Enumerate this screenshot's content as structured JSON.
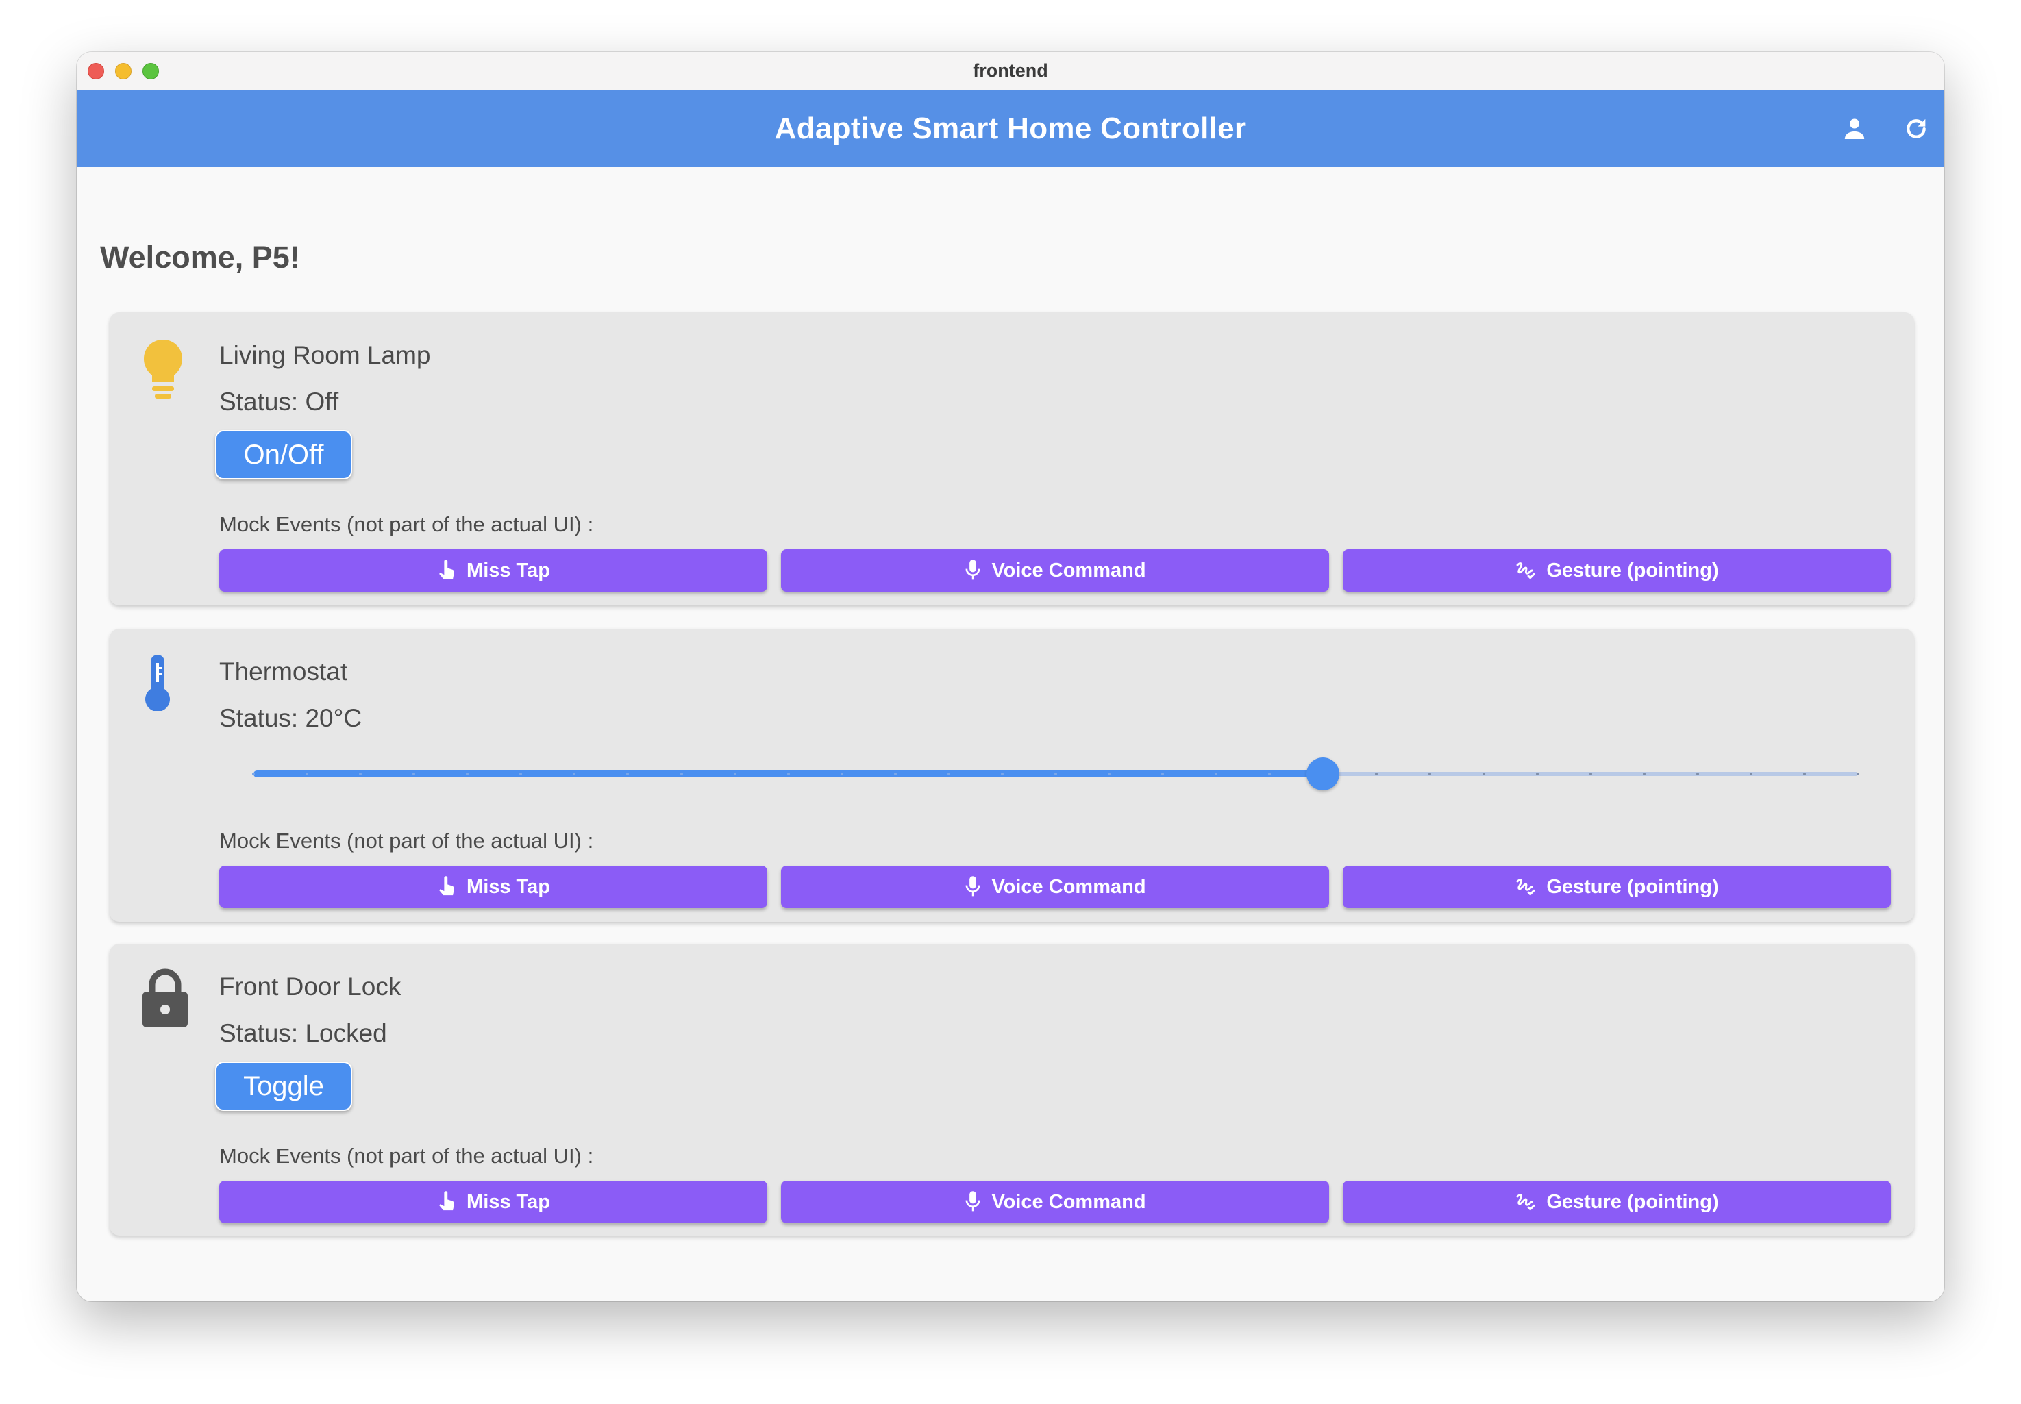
{
  "window": {
    "title": "frontend"
  },
  "appbar": {
    "title": "Adaptive Smart Home Controller",
    "account_icon": "person-icon",
    "refresh_icon": "refresh-icon"
  },
  "welcome": "Welcome, P5!",
  "mock_events_label": "Mock Events (not part of the actual UI) :",
  "mock_buttons": {
    "miss_tap": "Miss Tap",
    "voice_command": "Voice Command",
    "gesture": "Gesture (pointing)"
  },
  "devices": [
    {
      "name": "Living Room Lamp",
      "status": "Status: Off",
      "icon": "lightbulb-icon",
      "icon_color": "#f2c13d",
      "action": "On/Off"
    },
    {
      "name": "Thermostat",
      "status": "Status: 20°C",
      "icon": "thermometer-icon",
      "icon_color": "#3f7de0",
      "slider": {
        "value": 20,
        "min": 0,
        "max": 30,
        "divisions": 30
      }
    },
    {
      "name": "Front Door Lock",
      "status": "Status: Locked",
      "icon": "lock-icon",
      "icon_color": "#555555",
      "action": "Toggle"
    }
  ],
  "colors": {
    "appbar": "#5690e6",
    "primary": "#4a8ff0",
    "mock": "#8b5cf6",
    "card": "#e7e7e7"
  }
}
